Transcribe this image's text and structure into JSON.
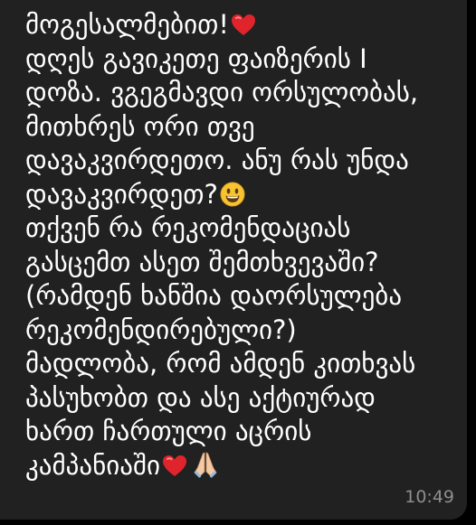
{
  "message": {
    "lines": [
      "მოგესალმებით!",
      "დღეს გავიკეთე ფაიზერის I",
      "დოზა. ვგეგმავდი ორსულობას,",
      "მითხრეს ორი თვე",
      "დავაკვირდეთო. ანუ რას უნდა",
      "დავაკვირდეთ?",
      "თქვენ რა რეკომენდაციას",
      "გასცემთ ასეთ შემთხვევაში?",
      "(რამდენ ხანშია დაორსულება",
      "რეკომენდირებული?)",
      "მადლობა, რომ ამდენ კითხვას",
      "პასუხობთ და ასე აქტიურად",
      "ხართ ჩართული აცრის",
      "კამპანიაში"
    ],
    "emojis": {
      "heart": "red-heart",
      "smile": "grinning-face",
      "pray": "folded-hands"
    },
    "timestamp": "10:49"
  },
  "colors": {
    "bubble": "#212121",
    "text": "#ffffff",
    "timestamp": "#8e8e93",
    "background": "#000000",
    "heart": "#e0242c",
    "smile": "#f7c331"
  }
}
